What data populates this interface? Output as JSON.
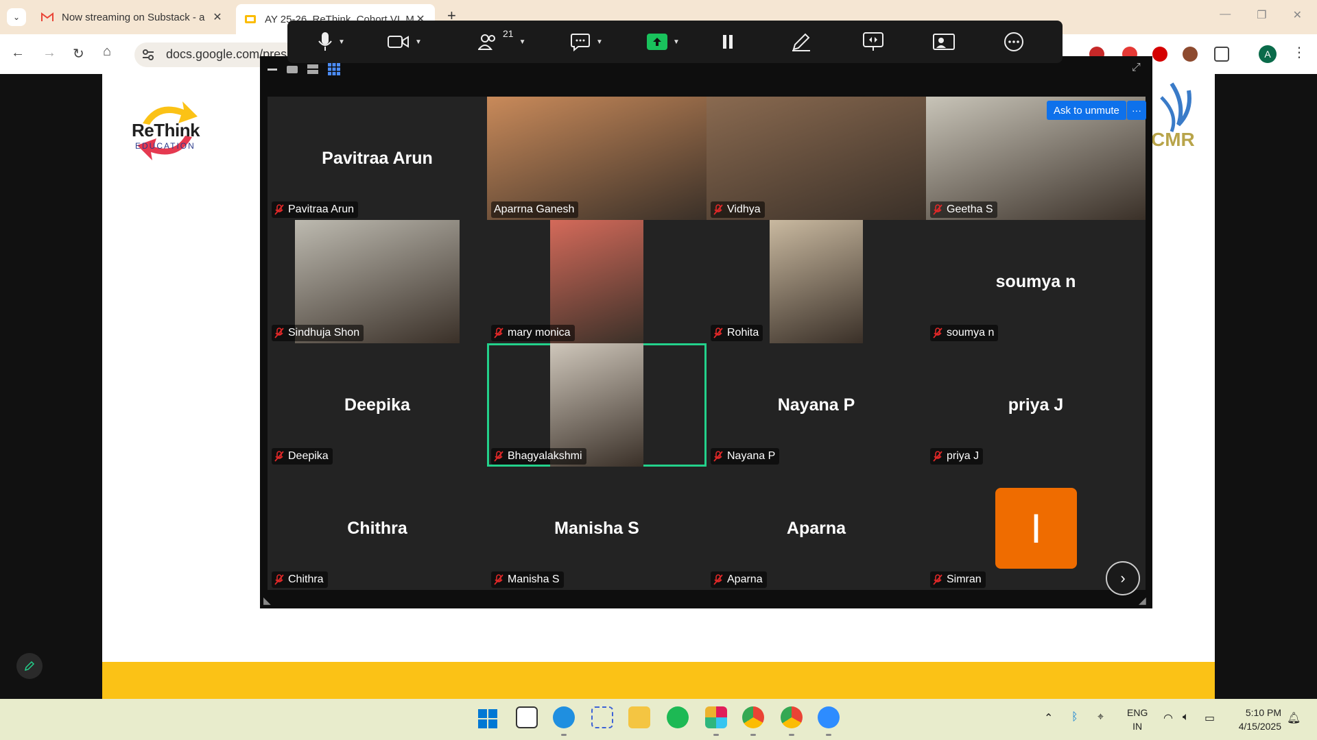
{
  "browser": {
    "tabs": [
      {
        "title": "Now streaming on Substack - a",
        "favicon": "gmail-icon",
        "active": false
      },
      {
        "title": "AY 25-26_ReThink_Cohort VI_M",
        "favicon": "slides-icon",
        "active": true
      }
    ],
    "url": "docs.google.com/pres"
  },
  "slide": {
    "logo_title": "ReThink",
    "logo_subtitle": "EDUCATION",
    "partner_logo": "CMR"
  },
  "zoom": {
    "participant_count": "21",
    "ask_unmute_label": "Ask to unmute",
    "tiles": [
      {
        "name": "Pavitraa Arun",
        "display": "Pavitraa Arun",
        "video": false,
        "muted": true
      },
      {
        "name": "Aparrna Ganesh",
        "video": true,
        "muted": false,
        "color": "#c98a5a"
      },
      {
        "name": "Vidhya",
        "video": true,
        "muted": true,
        "color": "#8a6a50"
      },
      {
        "name": "Geetha S",
        "video": true,
        "muted": true,
        "color": "#c8c4b8"
      },
      {
        "name": "Sindhuja Shon",
        "video": true,
        "muted": true,
        "color": "#bdbab0"
      },
      {
        "name": "mary monica",
        "video": true,
        "muted": true,
        "color": "#d46a5a"
      },
      {
        "name": "Rohita",
        "video": true,
        "muted": true,
        "color": "#c9b9a0"
      },
      {
        "name": "soumya n",
        "display": "soumya n",
        "video": false,
        "muted": true
      },
      {
        "name": "Deepika",
        "display": "Deepika",
        "video": false,
        "muted": true
      },
      {
        "name": "Bhagyalakshmi",
        "video": true,
        "muted": true,
        "speaking": true,
        "color": "#cfc7bb"
      },
      {
        "name": "Nayana P",
        "display": "Nayana P",
        "video": false,
        "muted": true
      },
      {
        "name": "priya J",
        "display": "priya J",
        "video": false,
        "muted": true
      },
      {
        "name": "Chithra",
        "display": "Chithra",
        "video": false,
        "muted": true
      },
      {
        "name": "Manisha S",
        "display": "Manisha S",
        "video": false,
        "muted": true
      },
      {
        "name": "Aparna",
        "display": "Aparna",
        "video": false,
        "muted": true
      },
      {
        "name": "Simran",
        "display": "I",
        "video": false,
        "muted": true,
        "avatar": true
      }
    ]
  },
  "taskbar": {
    "lang_line1": "ENG",
    "lang_line2": "IN",
    "time": "5:10 PM",
    "date": "4/15/2025"
  },
  "colors": {
    "speaking_outline": "#23d18b",
    "zoom_blue": "#0e71eb",
    "avatar_orange": "#ef6c00",
    "slide_bar": "#fbc216"
  }
}
